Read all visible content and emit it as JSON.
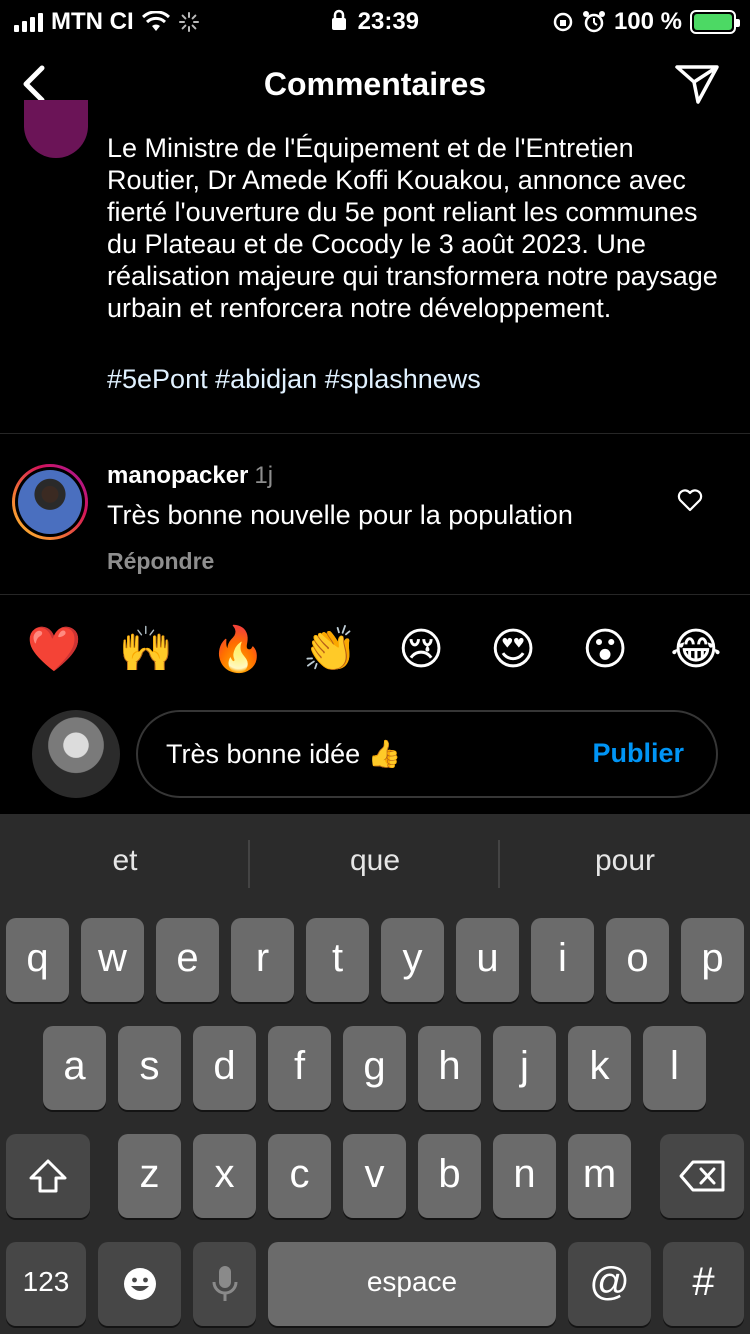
{
  "status_bar": {
    "carrier": "MTN CI",
    "time": "23:39",
    "battery": "100 %"
  },
  "header": {
    "title": "Commentaires",
    "back_icon": "chevron-left-icon",
    "send_icon": "paper-plane-icon"
  },
  "caption": {
    "text": "Le Ministre de l'Équipement et de l'Entretien Routier, Dr Amede Koffi Kouakou, annonce avec fierté l'ouverture du 5e pont reliant les communes du Plateau et de Cocody le 3 août 2023. Une réalisation majeure qui transformera notre paysage urbain et renforcera notre développement.",
    "hashtags": "#5ePont #abidjan #splashnews"
  },
  "comment": {
    "username": "manopacker",
    "time": "1j",
    "text": "Très bonne nouvelle pour la population",
    "reply_label": "Répondre"
  },
  "emoji_reactions": [
    "❤️",
    "🙌",
    "🔥",
    "👏",
    "😢",
    "😍",
    "😮",
    "😂"
  ],
  "composer": {
    "text": "Très bonne idée 👍",
    "publish_label": "Publier"
  },
  "keyboard": {
    "suggestions": [
      "et",
      "que",
      "pour"
    ],
    "row1": [
      "q",
      "w",
      "e",
      "r",
      "t",
      "y",
      "u",
      "i",
      "o",
      "p"
    ],
    "row2": [
      "a",
      "s",
      "d",
      "f",
      "g",
      "h",
      "j",
      "k",
      "l"
    ],
    "row3": [
      "z",
      "x",
      "c",
      "v",
      "b",
      "n",
      "m"
    ],
    "numbers_label": "123",
    "space_label": "espace",
    "at_label": "@",
    "hash_label": "#"
  },
  "colors": {
    "accent": "#0095f6",
    "background": "#000000",
    "keyboard_bg": "#2b2b2b",
    "battery_fill": "#4cd964"
  }
}
